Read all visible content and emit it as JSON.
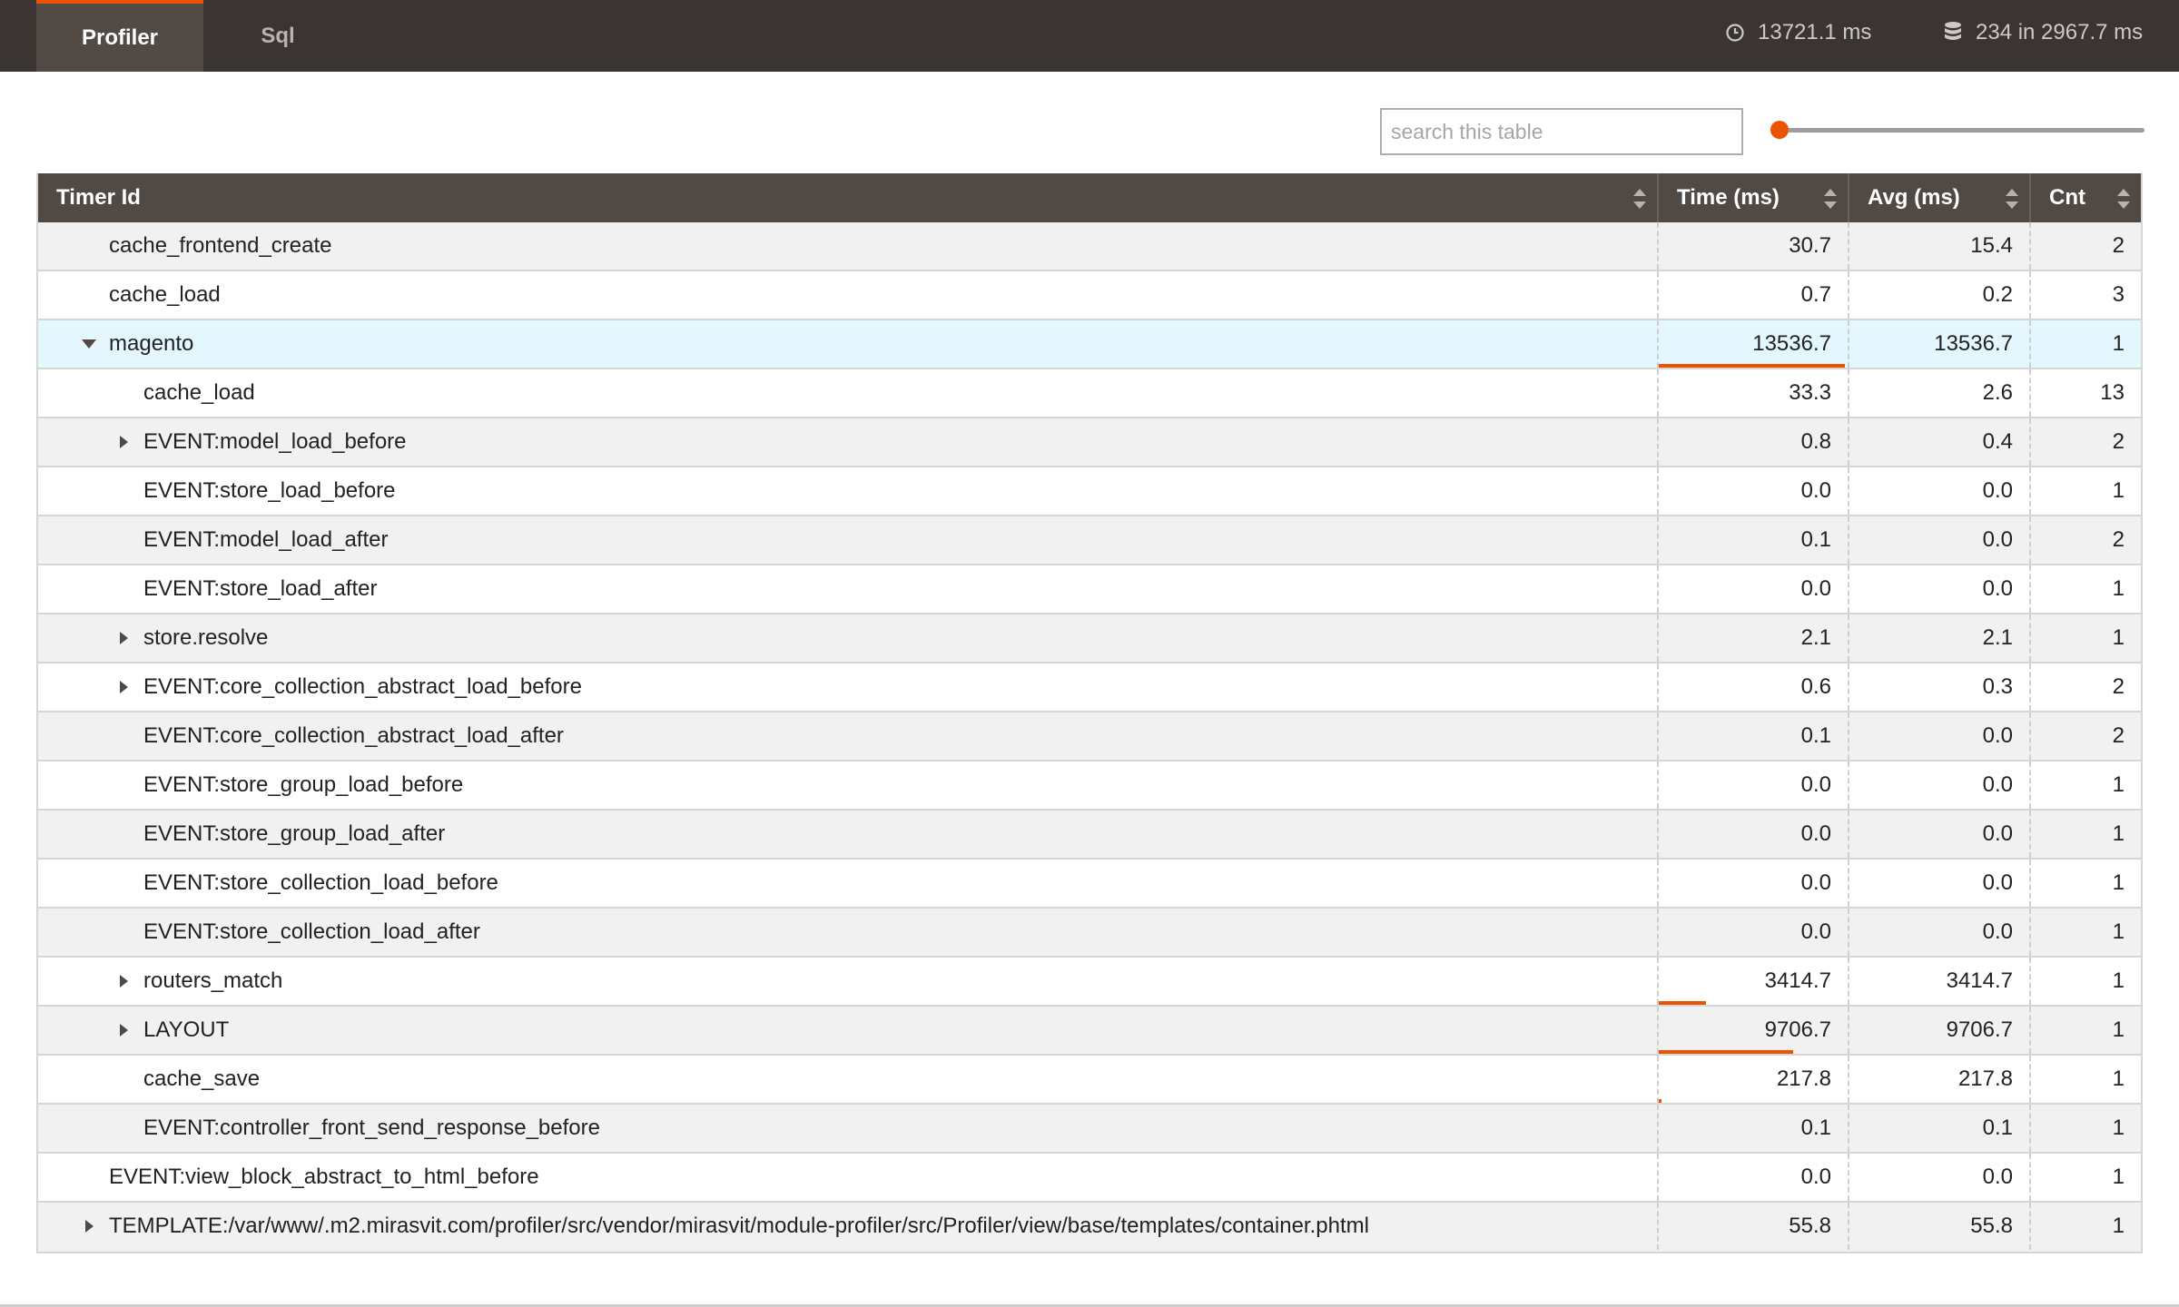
{
  "tabs": [
    {
      "label": "Profiler",
      "active": true
    },
    {
      "label": "Sql",
      "active": false
    }
  ],
  "stats": {
    "total_time": "13721.1 ms",
    "queries": "234 in 2967.7 ms",
    "time_icon": "clock-icon",
    "db_icon": "database-icon"
  },
  "search": {
    "placeholder": "search this table",
    "value": ""
  },
  "slider": {
    "value_fraction": 0
  },
  "colors": {
    "accent": "#eb5202",
    "header_bg": "#514944",
    "topbar_bg": "#3a3532",
    "selected_row": "#e5f7fe"
  },
  "table": {
    "columns": [
      "Timer Id",
      "Time (ms)",
      "Avg (ms)",
      "Cnt"
    ],
    "rows": [
      {
        "id": "cache_frontend_create",
        "depth": 0,
        "toggle": "none",
        "time": "30.7",
        "avg": "15.4",
        "cnt": "2",
        "time_share": 0
      },
      {
        "id": "cache_load",
        "depth": 0,
        "toggle": "none",
        "time": "0.7",
        "avg": "0.2",
        "cnt": "3",
        "time_share": 0
      },
      {
        "id": "magento",
        "depth": 0,
        "toggle": "expanded",
        "time": "13536.7",
        "avg": "13536.7",
        "cnt": "1",
        "time_share": 0.987,
        "selected": true
      },
      {
        "id": "cache_load",
        "depth": 1,
        "toggle": "none",
        "time": "33.3",
        "avg": "2.6",
        "cnt": "13",
        "time_share": 0
      },
      {
        "id": "EVENT:model_load_before",
        "depth": 1,
        "toggle": "collapsed",
        "time": "0.8",
        "avg": "0.4",
        "cnt": "2",
        "time_share": 0
      },
      {
        "id": "EVENT:store_load_before",
        "depth": 1,
        "toggle": "none",
        "time": "0.0",
        "avg": "0.0",
        "cnt": "1",
        "time_share": 0
      },
      {
        "id": "EVENT:model_load_after",
        "depth": 1,
        "toggle": "none",
        "time": "0.1",
        "avg": "0.0",
        "cnt": "2",
        "time_share": 0
      },
      {
        "id": "EVENT:store_load_after",
        "depth": 1,
        "toggle": "none",
        "time": "0.0",
        "avg": "0.0",
        "cnt": "1",
        "time_share": 0
      },
      {
        "id": "store.resolve",
        "depth": 1,
        "toggle": "collapsed",
        "time": "2.1",
        "avg": "2.1",
        "cnt": "1",
        "time_share": 0
      },
      {
        "id": "EVENT:core_collection_abstract_load_before",
        "depth": 1,
        "toggle": "collapsed",
        "time": "0.6",
        "avg": "0.3",
        "cnt": "2",
        "time_share": 0
      },
      {
        "id": "EVENT:core_collection_abstract_load_after",
        "depth": 1,
        "toggle": "none",
        "time": "0.1",
        "avg": "0.0",
        "cnt": "2",
        "time_share": 0
      },
      {
        "id": "EVENT:store_group_load_before",
        "depth": 1,
        "toggle": "none",
        "time": "0.0",
        "avg": "0.0",
        "cnt": "1",
        "time_share": 0
      },
      {
        "id": "EVENT:store_group_load_after",
        "depth": 1,
        "toggle": "none",
        "time": "0.0",
        "avg": "0.0",
        "cnt": "1",
        "time_share": 0
      },
      {
        "id": "EVENT:store_collection_load_before",
        "depth": 1,
        "toggle": "none",
        "time": "0.0",
        "avg": "0.0",
        "cnt": "1",
        "time_share": 0
      },
      {
        "id": "EVENT:store_collection_load_after",
        "depth": 1,
        "toggle": "none",
        "time": "0.0",
        "avg": "0.0",
        "cnt": "1",
        "time_share": 0
      },
      {
        "id": "routers_match",
        "depth": 1,
        "toggle": "collapsed",
        "time": "3414.7",
        "avg": "3414.7",
        "cnt": "1",
        "time_share": 0.25
      },
      {
        "id": "LAYOUT",
        "depth": 1,
        "toggle": "collapsed",
        "time": "9706.7",
        "avg": "9706.7",
        "cnt": "1",
        "time_share": 0.71
      },
      {
        "id": "cache_save",
        "depth": 1,
        "toggle": "none",
        "time": "217.8",
        "avg": "217.8",
        "cnt": "1",
        "time_share": 0.016
      },
      {
        "id": "EVENT:controller_front_send_response_before",
        "depth": 1,
        "toggle": "none",
        "time": "0.1",
        "avg": "0.1",
        "cnt": "1",
        "time_share": 0
      },
      {
        "id": "EVENT:view_block_abstract_to_html_before",
        "depth": 0,
        "toggle": "none",
        "time": "0.0",
        "avg": "0.0",
        "cnt": "1",
        "time_share": 0
      },
      {
        "id": "TEMPLATE:/var/www/.m2.mirasvit.com/profiler/src/vendor/mirasvit/module-profiler/src/Profiler/view/base/templates/container.phtml",
        "depth": 0,
        "toggle": "collapsed",
        "time": "55.8",
        "avg": "55.8",
        "cnt": "1",
        "time_share": 0
      }
    ]
  }
}
